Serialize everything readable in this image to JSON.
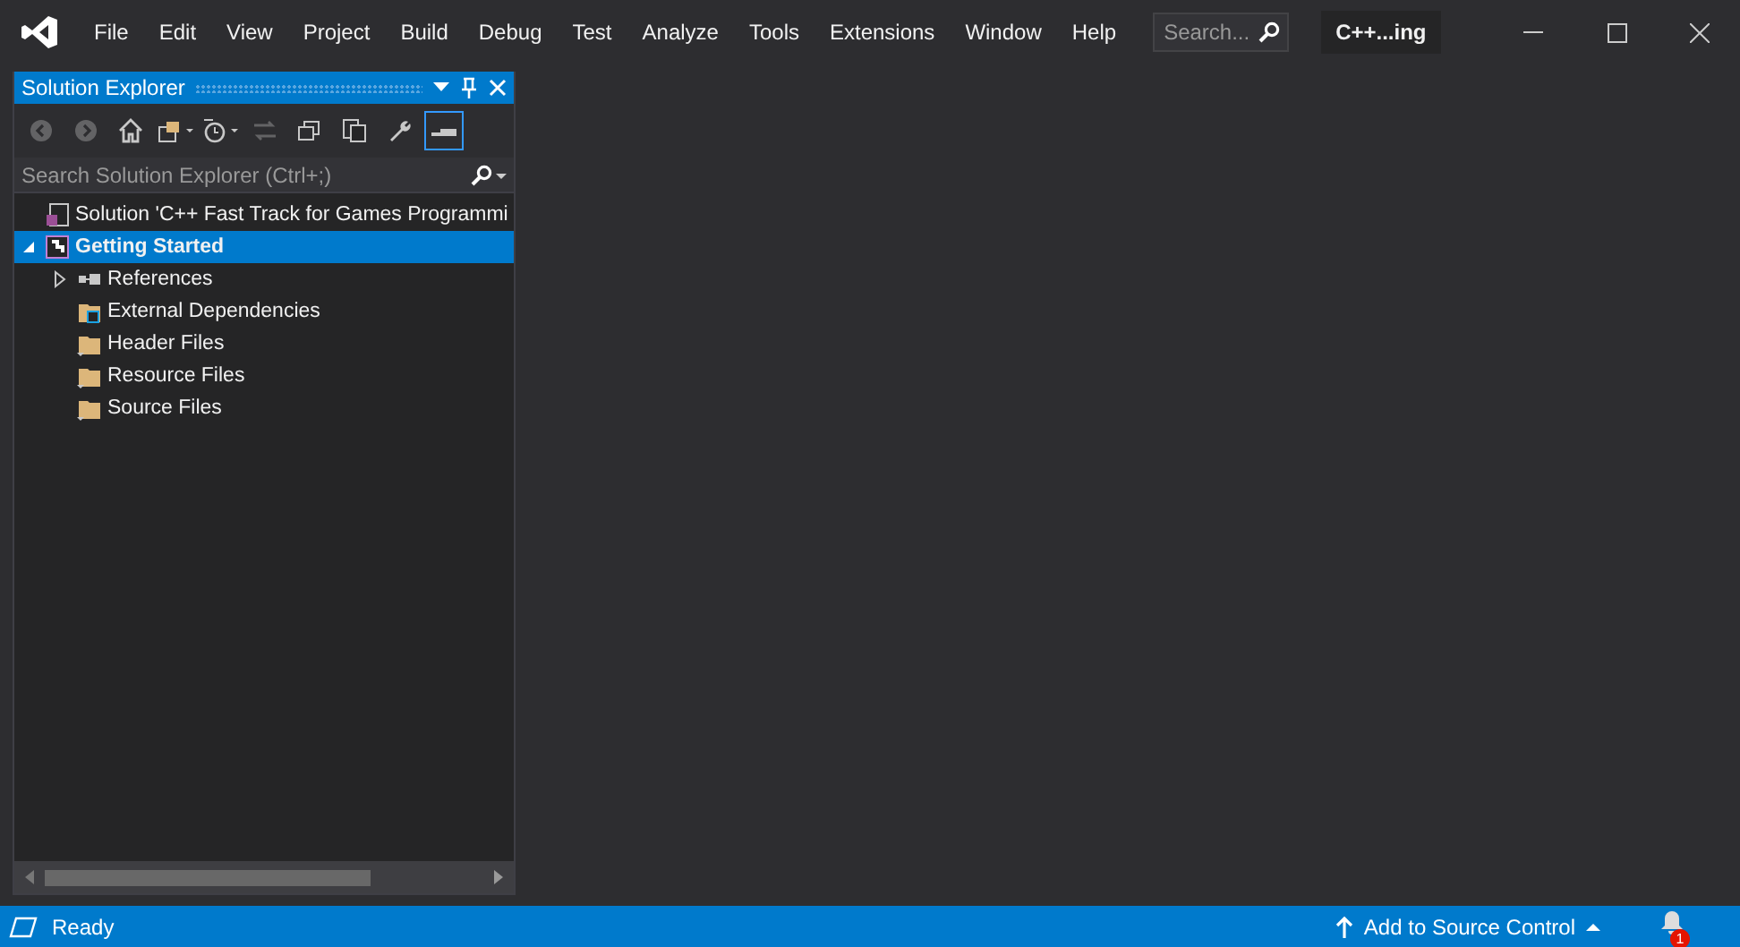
{
  "menu": [
    "File",
    "Edit",
    "View",
    "Project",
    "Build",
    "Debug",
    "Test",
    "Analyze",
    "Tools",
    "Extensions",
    "Window",
    "Help"
  ],
  "search": {
    "placeholder": "Search..."
  },
  "solution_name": "C++...ing",
  "panel": {
    "title": "Solution Explorer",
    "toolbar": [
      {
        "kind": "back",
        "disabled": true
      },
      {
        "kind": "forward",
        "disabled": true
      },
      {
        "kind": "home",
        "disabled": false
      },
      {
        "kind": "switch-views",
        "disabled": false
      },
      {
        "kind": "history",
        "disabled": false
      },
      {
        "kind": "sync",
        "disabled": true
      },
      {
        "kind": "collapse",
        "disabled": false
      },
      {
        "kind": "copy",
        "disabled": false
      },
      {
        "kind": "properties",
        "disabled": false
      },
      {
        "kind": "preview",
        "disabled": false,
        "on": true
      }
    ],
    "search": {
      "placeholder": "Search Solution Explorer (Ctrl+;)"
    },
    "tree": [
      {
        "label": "Solution 'C++ Fast Track for Games Programmi",
        "kind": "solution",
        "selected": false
      },
      {
        "label": "Getting Started",
        "kind": "project",
        "selected": true,
        "expanded": true,
        "children": [
          {
            "label": "References",
            "kind": "references",
            "selected": false,
            "expanded": false
          },
          {
            "label": "External Dependencies",
            "kind": "external",
            "selected": false
          },
          {
            "label": "Header Files",
            "kind": "filter",
            "selected": false
          },
          {
            "label": "Resource Files",
            "kind": "filter",
            "selected": false
          },
          {
            "label": "Source Files",
            "kind": "filter",
            "selected": false
          }
        ]
      }
    ]
  },
  "status_bar": {
    "text": "Ready",
    "source_control": "Add to Source Control",
    "notifications": "1"
  }
}
